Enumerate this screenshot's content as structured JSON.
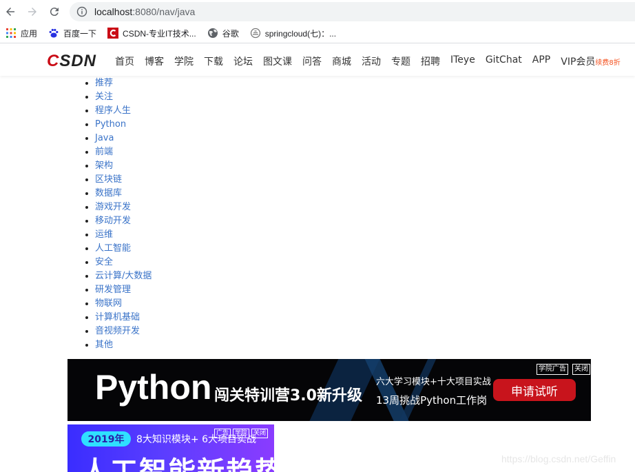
{
  "browser": {
    "url_host": "localhost",
    "url_rest": ":8080/nav/java"
  },
  "bookmarks": [
    {
      "label": "应用",
      "icon": "apps-grid-icon"
    },
    {
      "label": "百度一下",
      "icon": "baidu-paw-icon"
    },
    {
      "label": "CSDN-专业IT技术...",
      "icon": "csdn-c-icon"
    },
    {
      "label": "谷歌",
      "icon": "globe-icon"
    },
    {
      "label": "springcloud(七)：...",
      "icon": "cloud-icon"
    }
  ],
  "header": {
    "logo": "CSDN",
    "nav": [
      "首页",
      "博客",
      "学院",
      "下载",
      "论坛",
      "图文课",
      "问答",
      "商城",
      "活动",
      "专题",
      "招聘",
      "ITeye",
      "GitChat",
      "APP",
      "VIP会员"
    ],
    "vip_promo": "续费8折"
  },
  "categories": [
    "推荐",
    "关注",
    "程序人生",
    "Python",
    "Java",
    "前端",
    "架构",
    "区块链",
    "数据库",
    "游戏开发",
    "移动开发",
    "运维",
    "人工智能",
    "安全",
    "云计算/大数据",
    "研发管理",
    "物联网",
    "计算机基础",
    "音视频开发",
    "其他"
  ],
  "banner": {
    "headline": "Python",
    "campaign": "闯关特训营3.0新升级",
    "line1": "六大学习模块+十大项目实战",
    "line2": "13周挑战Python工作岗",
    "cta": "申请试听",
    "tag_ad": "学院广告",
    "tag_close": "关闭"
  },
  "ad2": {
    "year": "2019年",
    "sub": "8大知识模块+ 6大项目实战",
    "headline": "人工智能新趋势",
    "tags": [
      "广告",
      "学院",
      "关闭"
    ]
  },
  "watermark": "https://blog.csdn.net/Geffin",
  "colors": {
    "link": "#3a73c8",
    "csdn_red": "#ca0c16",
    "cta_red": "#c8141c",
    "promo_orange": "#f4511e"
  }
}
